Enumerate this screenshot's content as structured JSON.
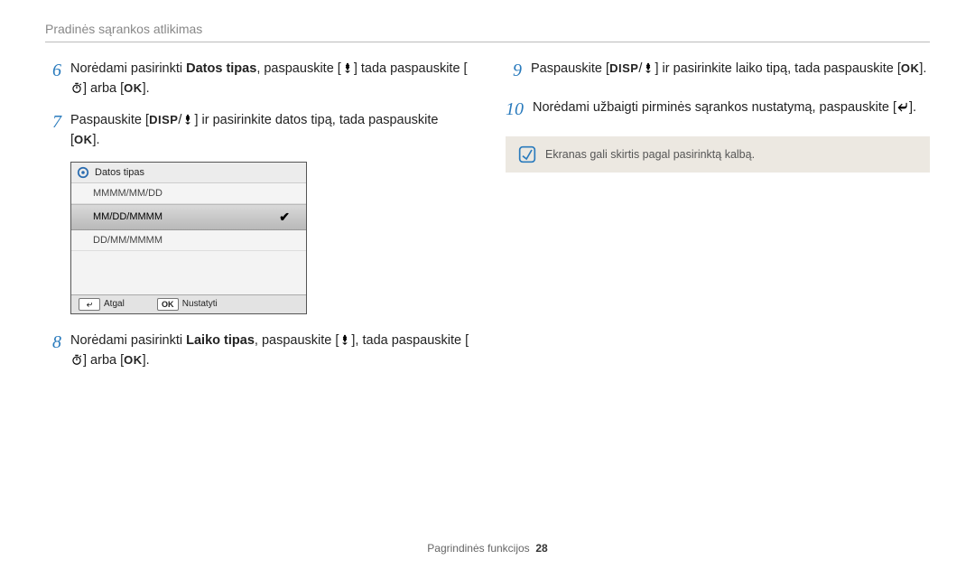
{
  "header": {
    "title": "Pradinės sąrankos atlikimas"
  },
  "left": {
    "steps": [
      {
        "num": "6",
        "prefix": "Norėdami pasirinkti ",
        "bold": "Datos tipas",
        "mid": ", paspauskite [",
        "after_icon": "] tada paspauskite [",
        "after_icon2": "] arba [",
        "ok": "OK",
        "end": "]."
      },
      {
        "num": "7",
        "prefix": "Paspauskite [",
        "disp": "DISP",
        "slash": "/",
        "after_icon": "] ir pasirinkite datos tipą, tada paspauskite [",
        "ok": "OK",
        "end": "]."
      },
      {
        "num": "8",
        "prefix": "Norėdami pasirinkti ",
        "bold": "Laiko tipas",
        "mid": ", paspauskite [",
        "after_icon": "], tada paspauskite [",
        "after_icon2": "] arba [",
        "ok": "OK",
        "end": "]."
      }
    ],
    "menu": {
      "title": "Datos tipas",
      "items": [
        "MMMM/MM/DD",
        "MM/DD/MMMM",
        "DD/MM/MMMM"
      ],
      "selected_index": 1,
      "footer": {
        "back_label": "Atgal",
        "set_key": "OK",
        "set_label": "Nustatyti"
      }
    }
  },
  "right": {
    "steps": [
      {
        "num": "9",
        "prefix": "Paspauskite [",
        "disp": "DISP",
        "slash": "/",
        "after_icon": "] ir pasirinkite laiko tipą, tada paspauskite [",
        "ok": "OK",
        "end": "]."
      },
      {
        "num": "10",
        "prefix": "Norėdami užbaigti pirminės sąrankos nustatymą, paspauskite [",
        "end": "]."
      }
    ],
    "note": "Ekranas gali skirtis pagal pasirinktą kalbą."
  },
  "footer": {
    "section": "Pagrindinės funkcijos",
    "page": "28"
  }
}
